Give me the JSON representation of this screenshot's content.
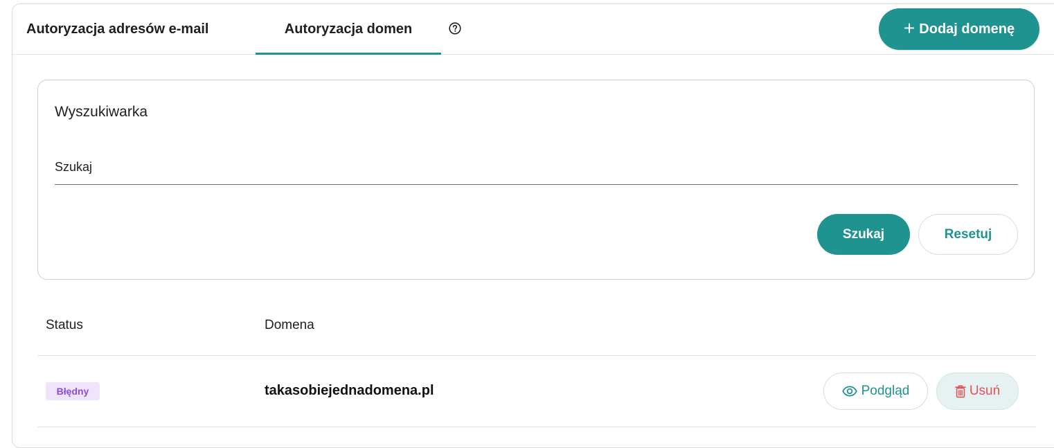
{
  "tabs": [
    {
      "label": "Autoryzacja adresów e-mail",
      "active": false
    },
    {
      "label": "Autoryzacja domen",
      "active": true
    }
  ],
  "header": {
    "help_icon": "question-circle-icon",
    "add_button_label": "Dodaj domenę",
    "add_button_icon": "plus-icon"
  },
  "search": {
    "title": "Wyszukiwarka",
    "placeholder": "Szukaj",
    "value": "",
    "search_button_label": "Szukaj",
    "reset_button_label": "Resetuj"
  },
  "table": {
    "columns": [
      "Status",
      "Domena"
    ],
    "rows": [
      {
        "status": "Błędny",
        "domain": "takasobiejednadomena.pl",
        "preview_label": "Podgląd",
        "delete_label": "Usuń"
      }
    ]
  },
  "colors": {
    "accent": "#1f938f",
    "danger": "#e0525a",
    "badge_bg": "#efe4fb",
    "badge_text": "#8a4fd1"
  }
}
